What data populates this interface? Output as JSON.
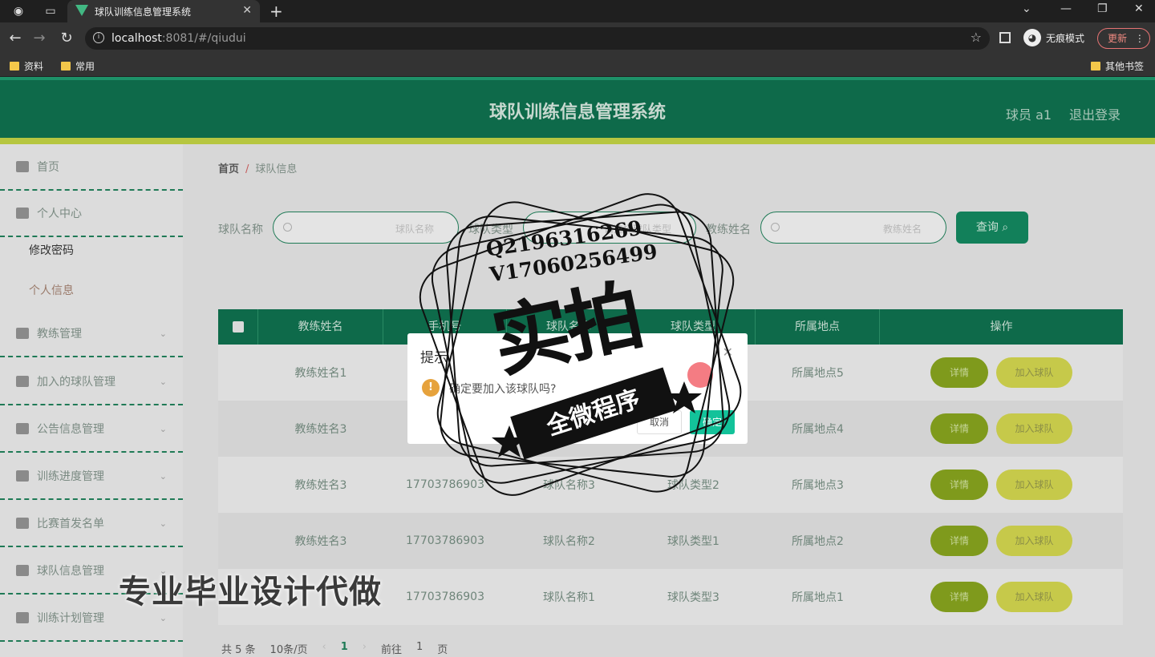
{
  "browser": {
    "tab_title": "球队训练信息管理系统",
    "url_host": "localhost",
    "url_rest": ":8081/#/qiudui",
    "incognito_label": "无痕模式",
    "update_label": "更新",
    "bookmarks": [
      "资料",
      "常用"
    ],
    "bookmarks_right": "其他书签"
  },
  "header": {
    "title": "球队训练信息管理系统",
    "user": "球员 a1",
    "logout": "退出登录"
  },
  "sidebar": {
    "items": [
      {
        "label": "首页",
        "icon": "home-icon"
      },
      {
        "label": "个人中心",
        "icon": "user-icon"
      },
      {
        "label": "教练管理",
        "icon": "checklist-icon"
      },
      {
        "label": "加入的球队管理",
        "icon": "briefcase-icon"
      },
      {
        "label": "公告信息管理",
        "icon": "image-icon"
      },
      {
        "label": "训练进度管理",
        "icon": "grid-icon"
      },
      {
        "label": "比赛首发名单",
        "icon": "list-icon"
      },
      {
        "label": "球队信息管理",
        "icon": "monitor-icon"
      },
      {
        "label": "训练计划管理",
        "icon": "chart-icon"
      }
    ],
    "sub_items": [
      "修改密码",
      "个人信息"
    ]
  },
  "breadcrumb": {
    "home": "首页",
    "separator": "/",
    "current": "球队信息"
  },
  "search": {
    "fields": [
      {
        "label": "球队名称",
        "placeholder": "球队名称"
      },
      {
        "label": "球队类型",
        "placeholder": "请选择球队类型"
      },
      {
        "label": "教练姓名",
        "placeholder": "教练姓名"
      }
    ],
    "button": "查询"
  },
  "table": {
    "headers": [
      "教练姓名",
      "手机号",
      "球队名称",
      "球队类型",
      "所属地点",
      "操作"
    ],
    "rows": [
      {
        "coach": "教练姓名1",
        "phone": "",
        "team": "",
        "type": "",
        "place": "所属地点5"
      },
      {
        "coach": "教练姓名3",
        "phone": "",
        "team": "",
        "type": "",
        "place": "所属地点4"
      },
      {
        "coach": "教练姓名3",
        "phone": "17703786903",
        "team": "球队名称3",
        "type": "球队类型2",
        "place": "所属地点3"
      },
      {
        "coach": "教练姓名3",
        "phone": "17703786903",
        "team": "球队名称2",
        "type": "球队类型1",
        "place": "所属地点2"
      },
      {
        "coach": "",
        "phone": "17703786903",
        "team": "球队名称1",
        "type": "球队类型3",
        "place": "所属地点1"
      }
    ],
    "detail_label": "详情",
    "join_label": "加入球队"
  },
  "pagination": {
    "total": "共 5 条",
    "page_size": "10条/页",
    "current": "1",
    "goto_prefix": "前往",
    "goto_value": "1",
    "goto_suffix": "页"
  },
  "modal": {
    "title": "提示",
    "message": "确定要加入该球队吗?",
    "cancel": "取消",
    "ok": "确定"
  },
  "watermark": {
    "contact_q": "Q2196316269",
    "contact_v": "V17060256499",
    "big": "实拍",
    "banner": "全微程序",
    "bottom": "专业毕业设计代做"
  }
}
